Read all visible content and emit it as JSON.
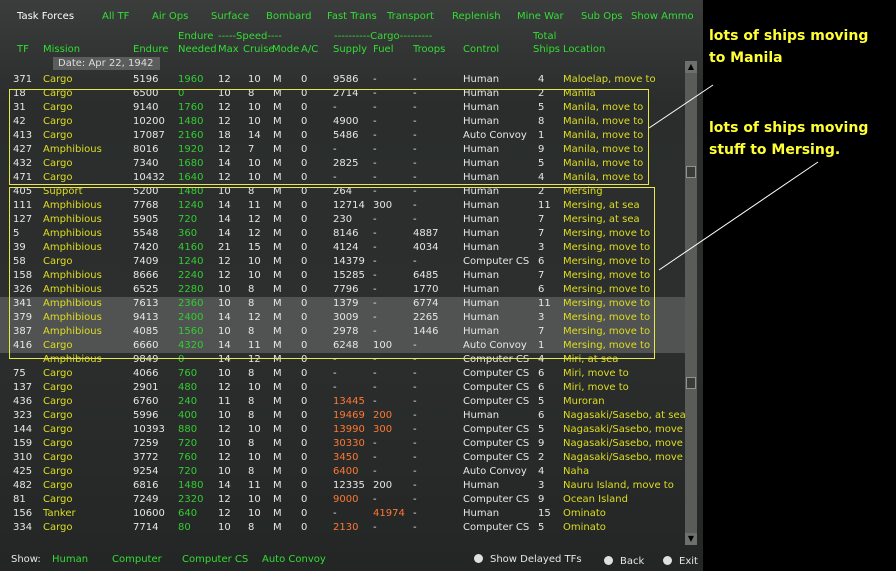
{
  "tabs": [
    "Task Forces",
    "All TF",
    "Air Ops",
    "Surface",
    "Bombard",
    "Fast Trans",
    "Transport",
    "Replenish",
    "Mine War",
    "Sub Ops",
    "Show Ammo"
  ],
  "headers": {
    "endure_top": "Endure",
    "speed_top": "-----Speed----",
    "cargo_top": "----------Cargo---------",
    "total_top": "Total",
    "tf": "TF",
    "mission": "Mission",
    "endure": "Endure",
    "needed": "Needed",
    "max": "Max",
    "cruise": "Cruise",
    "mode": "Mode",
    "ac": "A/C",
    "supply": "Supply",
    "fuel": "Fuel",
    "troops": "Troops",
    "control": "Control",
    "ships": "Ships",
    "location": "Location"
  },
  "date": "Date: Apr 22, 1942",
  "rows": [
    {
      "tf": "371",
      "mission": "Cargo",
      "endure": "5196",
      "needed": "1960",
      "max": "12",
      "cruise": "10",
      "mode": "M",
      "ac": "0",
      "supply": "9586",
      "fuel": "-",
      "troops": "-",
      "control": "Human",
      "ships": "4",
      "location": "Maloelap, move to",
      "mc": "y",
      "nc": "g",
      "sc": "w",
      "fc": "w"
    },
    {
      "tf": "18",
      "mission": "Cargo",
      "endure": "6500",
      "needed": "0",
      "max": "10",
      "cruise": "8",
      "mode": "M",
      "ac": "0",
      "supply": "2714",
      "fuel": "-",
      "troops": "-",
      "control": "Human",
      "ships": "2",
      "location": "Manila",
      "mc": "y",
      "nc": "g",
      "sc": "w",
      "fc": "w"
    },
    {
      "tf": "31",
      "mission": "Cargo",
      "endure": "9140",
      "needed": "1760",
      "max": "12",
      "cruise": "10",
      "mode": "M",
      "ac": "0",
      "supply": "-",
      "fuel": "-",
      "troops": "-",
      "control": "Human",
      "ships": "5",
      "location": "Manila, move to",
      "mc": "y",
      "nc": "g",
      "sc": "w",
      "fc": "w"
    },
    {
      "tf": "42",
      "mission": "Cargo",
      "endure": "10200",
      "needed": "1480",
      "max": "12",
      "cruise": "10",
      "mode": "M",
      "ac": "0",
      "supply": "4900",
      "fuel": "-",
      "troops": "-",
      "control": "Human",
      "ships": "8",
      "location": "Manila, move to",
      "mc": "y",
      "nc": "g",
      "sc": "w",
      "fc": "w"
    },
    {
      "tf": "413",
      "mission": "Cargo",
      "endure": "17087",
      "needed": "2160",
      "max": "18",
      "cruise": "14",
      "mode": "M",
      "ac": "0",
      "supply": "5486",
      "fuel": "-",
      "troops": "-",
      "control": "Auto Convoy",
      "ships": "1",
      "location": "Manila, move to",
      "mc": "y",
      "nc": "g",
      "sc": "w",
      "fc": "w"
    },
    {
      "tf": "427",
      "mission": "Amphibious",
      "endure": "8016",
      "needed": "1920",
      "max": "12",
      "cruise": "7",
      "mode": "M",
      "ac": "0",
      "supply": "-",
      "fuel": "-",
      "troops": "-",
      "control": "Human",
      "ships": "9",
      "location": "Manila, move to",
      "mc": "y",
      "nc": "g",
      "sc": "w",
      "fc": "w"
    },
    {
      "tf": "432",
      "mission": "Cargo",
      "endure": "7340",
      "needed": "1680",
      "max": "14",
      "cruise": "10",
      "mode": "M",
      "ac": "0",
      "supply": "2825",
      "fuel": "-",
      "troops": "-",
      "control": "Human",
      "ships": "5",
      "location": "Manila, move to",
      "mc": "y",
      "nc": "g",
      "sc": "w",
      "fc": "w"
    },
    {
      "tf": "471",
      "mission": "Cargo",
      "endure": "10432",
      "needed": "1640",
      "max": "12",
      "cruise": "10",
      "mode": "M",
      "ac": "0",
      "supply": "-",
      "fuel": "-",
      "troops": "-",
      "control": "Human",
      "ships": "4",
      "location": "Manila, move to",
      "mc": "y",
      "nc": "g",
      "sc": "w",
      "fc": "w"
    },
    {
      "tf": "405",
      "mission": "Support",
      "endure": "5200",
      "needed": "1480",
      "max": "10",
      "cruise": "8",
      "mode": "M",
      "ac": "0",
      "supply": "264",
      "fuel": "-",
      "troops": "-",
      "control": "Human",
      "ships": "2",
      "location": "Mersing",
      "mc": "y",
      "nc": "g",
      "sc": "w",
      "fc": "w"
    },
    {
      "tf": "111",
      "mission": "Amphibious",
      "endure": "7768",
      "needed": "1240",
      "max": "14",
      "cruise": "11",
      "mode": "M",
      "ac": "0",
      "supply": "12714",
      "fuel": "300",
      "troops": "-",
      "control": "Human",
      "ships": "11",
      "location": "Mersing, at sea",
      "mc": "y",
      "nc": "g",
      "sc": "w",
      "fc": "w"
    },
    {
      "tf": "127",
      "mission": "Amphibious",
      "endure": "5905",
      "needed": "720",
      "max": "14",
      "cruise": "12",
      "mode": "M",
      "ac": "0",
      "supply": "230",
      "fuel": "-",
      "troops": "-",
      "control": "Human",
      "ships": "7",
      "location": "Mersing, at sea",
      "mc": "y",
      "nc": "g",
      "sc": "w",
      "fc": "w"
    },
    {
      "tf": "5",
      "mission": "Amphibious",
      "endure": "5548",
      "needed": "360",
      "max": "14",
      "cruise": "12",
      "mode": "M",
      "ac": "0",
      "supply": "8146",
      "fuel": "-",
      "troops": "4887",
      "control": "Human",
      "ships": "7",
      "location": "Mersing, move to",
      "mc": "y",
      "nc": "g",
      "sc": "w",
      "fc": "w"
    },
    {
      "tf": "39",
      "mission": "Amphibious",
      "endure": "7420",
      "needed": "4160",
      "max": "21",
      "cruise": "15",
      "mode": "M",
      "ac": "0",
      "supply": "4124",
      "fuel": "-",
      "troops": "4034",
      "control": "Human",
      "ships": "3",
      "location": "Mersing, move to",
      "mc": "y",
      "nc": "g",
      "sc": "w",
      "fc": "w"
    },
    {
      "tf": "58",
      "mission": "Cargo",
      "endure": "7409",
      "needed": "1240",
      "max": "12",
      "cruise": "10",
      "mode": "M",
      "ac": "0",
      "supply": "14379",
      "fuel": "-",
      "troops": "-",
      "control": "Computer CS",
      "ships": "6",
      "location": "Mersing, move to",
      "mc": "y",
      "nc": "g",
      "sc": "w",
      "fc": "w"
    },
    {
      "tf": "158",
      "mission": "Amphibious",
      "endure": "8666",
      "needed": "2240",
      "max": "12",
      "cruise": "10",
      "mode": "M",
      "ac": "0",
      "supply": "15285",
      "fuel": "-",
      "troops": "6485",
      "control": "Human",
      "ships": "7",
      "location": "Mersing, move to",
      "mc": "y",
      "nc": "g",
      "sc": "w",
      "fc": "w"
    },
    {
      "tf": "326",
      "mission": "Amphibious",
      "endure": "6525",
      "needed": "2280",
      "max": "10",
      "cruise": "8",
      "mode": "M",
      "ac": "0",
      "supply": "7796",
      "fuel": "-",
      "troops": "1770",
      "control": "Human",
      "ships": "6",
      "location": "Mersing, move to",
      "mc": "y",
      "nc": "g",
      "sc": "w",
      "fc": "w"
    },
    {
      "tf": "341",
      "mission": "Amphibious",
      "endure": "7613",
      "needed": "2360",
      "max": "10",
      "cruise": "8",
      "mode": "M",
      "ac": "0",
      "supply": "1379",
      "fuel": "-",
      "troops": "6774",
      "control": "Human",
      "ships": "11",
      "location": "Mersing, move to",
      "mc": "y",
      "nc": "g",
      "sc": "w",
      "fc": "w",
      "hl": true
    },
    {
      "tf": "379",
      "mission": "Amphibious",
      "endure": "9413",
      "needed": "2400",
      "max": "14",
      "cruise": "12",
      "mode": "M",
      "ac": "0",
      "supply": "3009",
      "fuel": "-",
      "troops": "2265",
      "control": "Human",
      "ships": "3",
      "location": "Mersing, move to",
      "mc": "y",
      "nc": "g",
      "sc": "w",
      "fc": "w",
      "hl": true
    },
    {
      "tf": "387",
      "mission": "Amphibious",
      "endure": "4085",
      "needed": "1560",
      "max": "10",
      "cruise": "8",
      "mode": "M",
      "ac": "0",
      "supply": "2978",
      "fuel": "-",
      "troops": "1446",
      "control": "Human",
      "ships": "7",
      "location": "Mersing, move to",
      "mc": "y",
      "nc": "g",
      "sc": "w",
      "fc": "w",
      "hl": true
    },
    {
      "tf": "416",
      "mission": "Cargo",
      "endure": "6660",
      "needed": "4320",
      "max": "14",
      "cruise": "11",
      "mode": "M",
      "ac": "0",
      "supply": "6248",
      "fuel": "100",
      "troops": "-",
      "control": "Auto Convoy",
      "ships": "1",
      "location": "Mersing, move to",
      "mc": "y",
      "nc": "g",
      "sc": "w",
      "fc": "w",
      "hl": true
    },
    {
      "tf": "",
      "mission": "Amphibious",
      "endure": "9849",
      "needed": "0",
      "max": "14",
      "cruise": "12",
      "mode": "M",
      "ac": "0",
      "supply": "-",
      "fuel": "-",
      "troops": "-",
      "control": "Computer CS",
      "ships": "4",
      "location": "Miri, at sea",
      "mc": "y",
      "nc": "g",
      "sc": "w",
      "fc": "w"
    },
    {
      "tf": "75",
      "mission": "Cargo",
      "endure": "4066",
      "needed": "760",
      "max": "10",
      "cruise": "8",
      "mode": "M",
      "ac": "0",
      "supply": "-",
      "fuel": "-",
      "troops": "-",
      "control": "Computer CS",
      "ships": "6",
      "location": "Miri, move to",
      "mc": "y",
      "nc": "g",
      "sc": "w",
      "fc": "w"
    },
    {
      "tf": "137",
      "mission": "Cargo",
      "endure": "2901",
      "needed": "480",
      "max": "12",
      "cruise": "10",
      "mode": "M",
      "ac": "0",
      "supply": "-",
      "fuel": "-",
      "troops": "-",
      "control": "Computer CS",
      "ships": "6",
      "location": "Miri, move to",
      "mc": "y",
      "nc": "g",
      "sc": "w",
      "fc": "w"
    },
    {
      "tf": "436",
      "mission": "Cargo",
      "endure": "6760",
      "needed": "240",
      "max": "11",
      "cruise": "8",
      "mode": "M",
      "ac": "0",
      "supply": "13445",
      "fuel": "-",
      "troops": "-",
      "control": "Computer CS",
      "ships": "5",
      "location": "Muroran",
      "mc": "y",
      "nc": "g",
      "sc": "o",
      "fc": "w"
    },
    {
      "tf": "323",
      "mission": "Cargo",
      "endure": "5996",
      "needed": "400",
      "max": "10",
      "cruise": "8",
      "mode": "M",
      "ac": "0",
      "supply": "19469",
      "fuel": "200",
      "troops": "-",
      "control": "Human",
      "ships": "6",
      "location": "Nagasaki/Sasebo, at sea",
      "mc": "y",
      "nc": "g",
      "sc": "o",
      "fc": "o"
    },
    {
      "tf": "144",
      "mission": "Cargo",
      "endure": "10393",
      "needed": "880",
      "max": "12",
      "cruise": "10",
      "mode": "M",
      "ac": "0",
      "supply": "13990",
      "fuel": "300",
      "troops": "-",
      "control": "Computer CS",
      "ships": "5",
      "location": "Nagasaki/Sasebo, move to",
      "mc": "y",
      "nc": "g",
      "sc": "o",
      "fc": "o"
    },
    {
      "tf": "159",
      "mission": "Cargo",
      "endure": "7259",
      "needed": "720",
      "max": "10",
      "cruise": "8",
      "mode": "M",
      "ac": "0",
      "supply": "30330",
      "fuel": "-",
      "troops": "-",
      "control": "Computer CS",
      "ships": "9",
      "location": "Nagasaki/Sasebo, move to",
      "mc": "y",
      "nc": "g",
      "sc": "o",
      "fc": "w"
    },
    {
      "tf": "310",
      "mission": "Cargo",
      "endure": "3772",
      "needed": "760",
      "max": "12",
      "cruise": "10",
      "mode": "M",
      "ac": "0",
      "supply": "3450",
      "fuel": "-",
      "troops": "-",
      "control": "Computer CS",
      "ships": "2",
      "location": "Nagasaki/Sasebo, move to",
      "mc": "y",
      "nc": "g",
      "sc": "o",
      "fc": "w"
    },
    {
      "tf": "425",
      "mission": "Cargo",
      "endure": "9254",
      "needed": "720",
      "max": "10",
      "cruise": "8",
      "mode": "M",
      "ac": "0",
      "supply": "6400",
      "fuel": "-",
      "troops": "-",
      "control": "Auto Convoy",
      "ships": "4",
      "location": "Naha",
      "mc": "y",
      "nc": "g",
      "sc": "o",
      "fc": "w"
    },
    {
      "tf": "482",
      "mission": "Cargo",
      "endure": "6816",
      "needed": "1480",
      "max": "14",
      "cruise": "11",
      "mode": "M",
      "ac": "0",
      "supply": "12335",
      "fuel": "200",
      "troops": "-",
      "control": "Human",
      "ships": "3",
      "location": "Nauru Island, move to",
      "mc": "y",
      "nc": "g",
      "sc": "w",
      "fc": "w"
    },
    {
      "tf": "81",
      "mission": "Cargo",
      "endure": "7249",
      "needed": "2320",
      "max": "12",
      "cruise": "10",
      "mode": "M",
      "ac": "0",
      "supply": "9000",
      "fuel": "-",
      "troops": "-",
      "control": "Computer CS",
      "ships": "9",
      "location": "Ocean Island",
      "mc": "y",
      "nc": "g",
      "sc": "o",
      "fc": "w"
    },
    {
      "tf": "156",
      "mission": "Tanker",
      "endure": "10600",
      "needed": "640",
      "max": "12",
      "cruise": "10",
      "mode": "M",
      "ac": "0",
      "supply": "-",
      "fuel": "41974",
      "troops": "-",
      "control": "Human",
      "ships": "15",
      "location": "Ominato",
      "mc": "y",
      "nc": "g",
      "sc": "w",
      "fc": "o"
    },
    {
      "tf": "334",
      "mission": "Cargo",
      "endure": "7714",
      "needed": "80",
      "max": "10",
      "cruise": "8",
      "mode": "M",
      "ac": "0",
      "supply": "2130",
      "fuel": "-",
      "troops": "-",
      "control": "Computer CS",
      "ships": "5",
      "location": "Ominato",
      "mc": "y",
      "nc": "g",
      "sc": "o",
      "fc": "w"
    }
  ],
  "footer": {
    "show_label": "Show:",
    "filters": [
      "Human",
      "Computer",
      "Computer CS",
      "Auto Convoy"
    ],
    "delayed": "Show Delayed TFs",
    "back": "Back",
    "exit": "Exit"
  },
  "annotations": {
    "manila": "lots of ships moving\nto Manila",
    "mersing": "lots of ships moving\nstuff to Mersing."
  },
  "colors": {
    "white_text": "#e6e6e6",
    "yellow_text": "#dddd22",
    "green_text": "#33cc33",
    "orange_text": "#ff7733",
    "highlight_box": "#e8e84a",
    "annotation": "#ffff33"
  }
}
